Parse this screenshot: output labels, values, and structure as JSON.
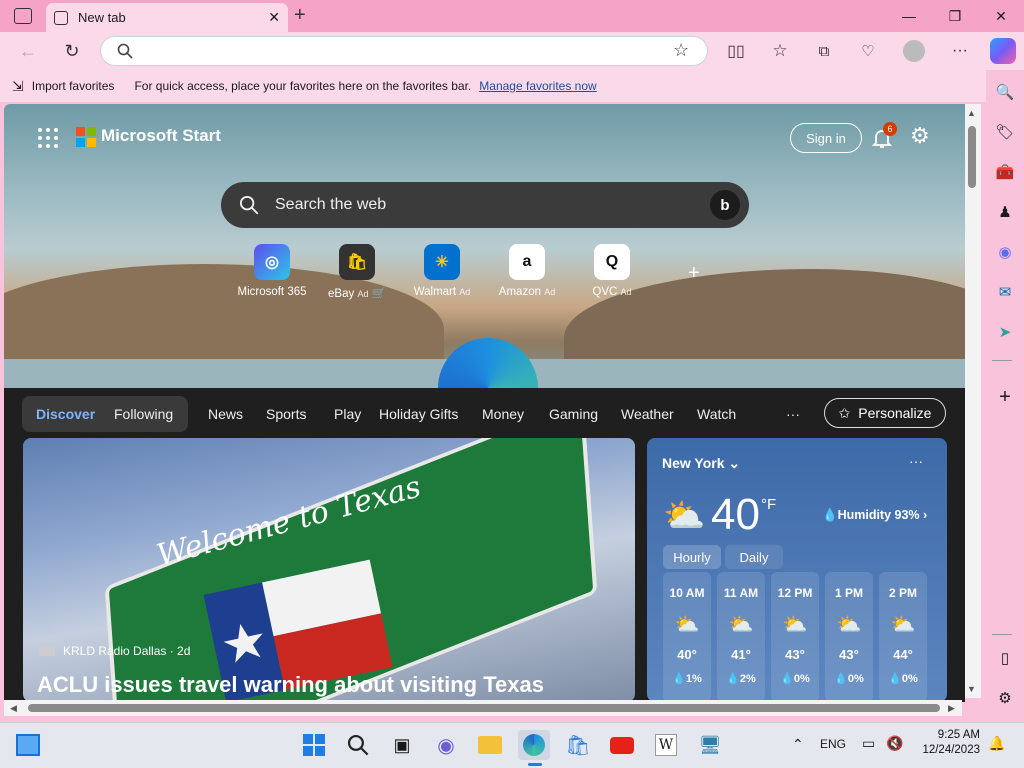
{
  "browser": {
    "tab_title": "New tab",
    "address_value": "",
    "favorites_bar": {
      "import_label": "Import favorites",
      "hint": "For quick access, place your favorites here on the favorites bar.",
      "manage_link": "Manage favorites now"
    }
  },
  "page": {
    "brand": "Microsoft Start",
    "sign_in": "Sign in",
    "notification_count": "6",
    "search_placeholder": "Search the web",
    "quick_links": [
      {
        "label": "Microsoft 365",
        "ad": ""
      },
      {
        "label": "eBay",
        "ad": "Ad"
      },
      {
        "label": "Walmart",
        "ad": "Ad"
      },
      {
        "label": "Amazon",
        "ad": "Ad"
      },
      {
        "label": "QVC",
        "ad": "Ad"
      }
    ],
    "nav": {
      "pills": [
        "Discover",
        "Following"
      ],
      "items": [
        "News",
        "Sports",
        "Play",
        "Holiday Gifts",
        "Money",
        "Gaming",
        "Weather",
        "Watch"
      ],
      "more": "···",
      "personalize": "Personalize"
    },
    "hero": {
      "sign_text": "Welcome to Texas",
      "source": "KRLD Radio Dallas · 2d",
      "headline": "ACLU issues travel warning about visiting Texas"
    },
    "weather": {
      "city": "New York",
      "temp": "40",
      "unit": "°F",
      "humidity": "Humidity 93%",
      "tabs": [
        "Hourly",
        "Daily"
      ],
      "hours": [
        {
          "time": "10 AM",
          "temp": "40°",
          "precip": "1%"
        },
        {
          "time": "11 AM",
          "temp": "41°",
          "precip": "2%"
        },
        {
          "time": "12 PM",
          "temp": "43°",
          "precip": "0%"
        },
        {
          "time": "1 PM",
          "temp": "43°",
          "precip": "0%"
        },
        {
          "time": "2 PM",
          "temp": "44°",
          "precip": "0%"
        }
      ]
    }
  },
  "taskbar": {
    "lang": "ENG",
    "time": "9:25 AM",
    "date": "12/24/2023"
  },
  "colors": {
    "titlebar": "#f5a3c7",
    "toolbar": "#fbd9e8",
    "accent": "#1a4fa0"
  }
}
